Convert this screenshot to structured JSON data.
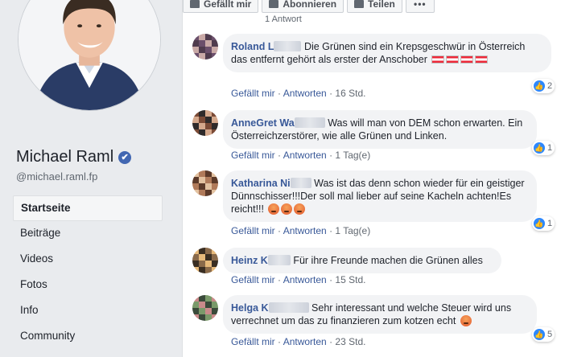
{
  "profile": {
    "name": "Michael Raml",
    "handle": "@michael.raml.fp",
    "verified_mark": "✔"
  },
  "nav": [
    {
      "label": "Startseite",
      "active": true
    },
    {
      "label": "Beiträge"
    },
    {
      "label": "Videos"
    },
    {
      "label": "Fotos"
    },
    {
      "label": "Info"
    },
    {
      "label": "Community"
    }
  ],
  "actions": {
    "like": "Gefällt mir",
    "follow": "Abonnieren",
    "share": "Teilen",
    "more": "•••",
    "prev_replies": "1 Antwort"
  },
  "meta_labels": {
    "like": "Gefällt mir",
    "reply": "Antworten",
    "sep": "·"
  },
  "comments": [
    {
      "author": "Roland L",
      "text": "Die Grünen sind ein Krepsgeschwür in Österreich das entfernt gehört als erster der Anschober",
      "time": "16 Std.",
      "likes": "2",
      "avatar_colors": [
        "#6b4f6b",
        "#c9a9a6",
        "#4f3b4d"
      ]
    },
    {
      "author": "AnneGret Wa",
      "text": "Was will man von DEM schon erwarten. Ein Österreichzerstörer, wie alle Grünen und Linken.",
      "time": "1 Tag(e)",
      "likes": "1",
      "avatar_colors": [
        "#d4a88c",
        "#7a4a36",
        "#2e2a2a"
      ]
    },
    {
      "author": "Katharina Ni",
      "text": "Was ist das denn schon wieder für ein geistiger Dünnschisser!!!Der soll mal lieber auf seine Kacheln achten!Es reicht!!!",
      "time": "1 Tag(e)",
      "likes": "1",
      "avatar_colors": [
        "#b07a5a",
        "#5c3a2a",
        "#e2c1a0"
      ]
    },
    {
      "author": "Heinz K",
      "text": "Für ihre Freunde machen die Grünen alles",
      "time": "15 Std.",
      "likes": "",
      "avatar_colors": [
        "#e6b97a",
        "#3a2e22",
        "#8a6a4a"
      ]
    },
    {
      "author": "Helga K",
      "text": "Sehr interessant und welche Steuer wird uns verrechnet um das zu finanzieren zum kotzen echt",
      "time": "23 Std.",
      "likes": "5",
      "avatar_colors": [
        "#7a9a6a",
        "#c98a8a",
        "#3a4a3a"
      ]
    }
  ],
  "colors": {
    "link": "#385898",
    "bubble": "#f2f3f5",
    "accent": "#4267b2",
    "like_blue": "#2d88ff"
  },
  "icons": [
    "thumbs-up-icon",
    "rss-icon",
    "share-icon",
    "more-icon",
    "verified-icon",
    "austrian-flag-icon",
    "angry-emoji-icon"
  ]
}
